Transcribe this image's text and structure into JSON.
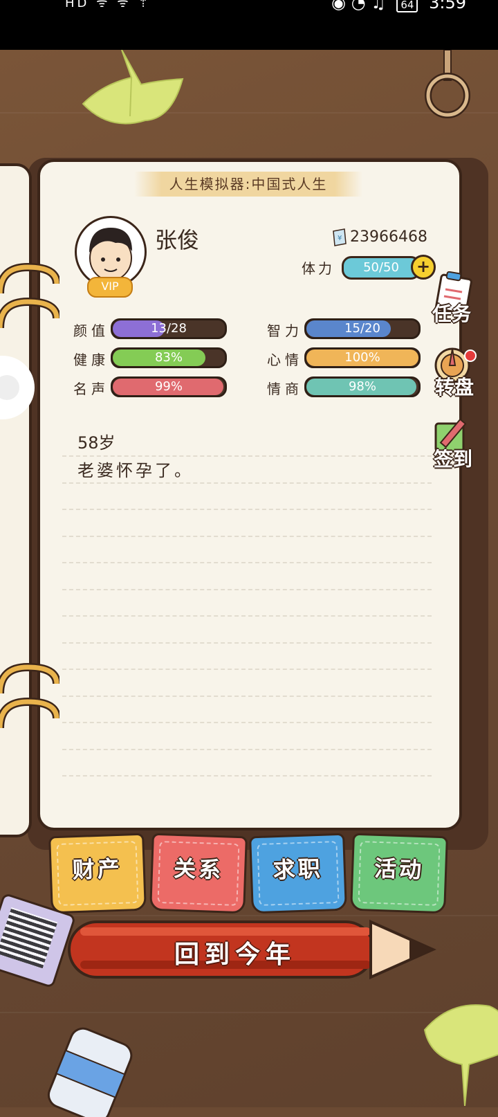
{
  "status_bar": {
    "left_icons": "HD ᯤ ᯤ ⇡",
    "battery": "64",
    "time": "3:59"
  },
  "page_title": "人生模拟器:中国式人生",
  "player": {
    "name": "张俊",
    "vip_label": "VIP",
    "money": "23966468",
    "stamina_label": "体力",
    "stamina_value": "50/50",
    "stamina_fraction": 1.0
  },
  "stats": [
    {
      "label": "颜值",
      "value": "13/28",
      "fraction": 0.464,
      "color": "#8d6fd6"
    },
    {
      "label": "智力",
      "value": "15/20",
      "fraction": 0.75,
      "color": "#5a86cc"
    },
    {
      "label": "健康",
      "value": "83%",
      "fraction": 0.83,
      "color": "#84cc55"
    },
    {
      "label": "心情",
      "value": "100%",
      "fraction": 1.0,
      "color": "#f0b558"
    },
    {
      "label": "名声",
      "value": "99%",
      "fraction": 0.99,
      "color": "#e06a6f"
    },
    {
      "label": "情商",
      "value": "98%",
      "fraction": 0.98,
      "color": "#6fc4b3"
    }
  ],
  "log": {
    "age": "58岁",
    "event": "老婆怀孕了。"
  },
  "side_menu": {
    "tasks": "任务",
    "wheel": "转盘",
    "checkin": "签到"
  },
  "tabs": [
    {
      "label": "财产",
      "color": "#f4c04f"
    },
    {
      "label": "关系",
      "color": "#ec6b67"
    },
    {
      "label": "求职",
      "color": "#4ea2e0"
    },
    {
      "label": "活动",
      "color": "#6dc77c"
    }
  ],
  "main_button": "回到今年",
  "icons": {
    "money": "ticket-icon",
    "plus": "plus-icon",
    "qr": "qr-code-icon"
  }
}
